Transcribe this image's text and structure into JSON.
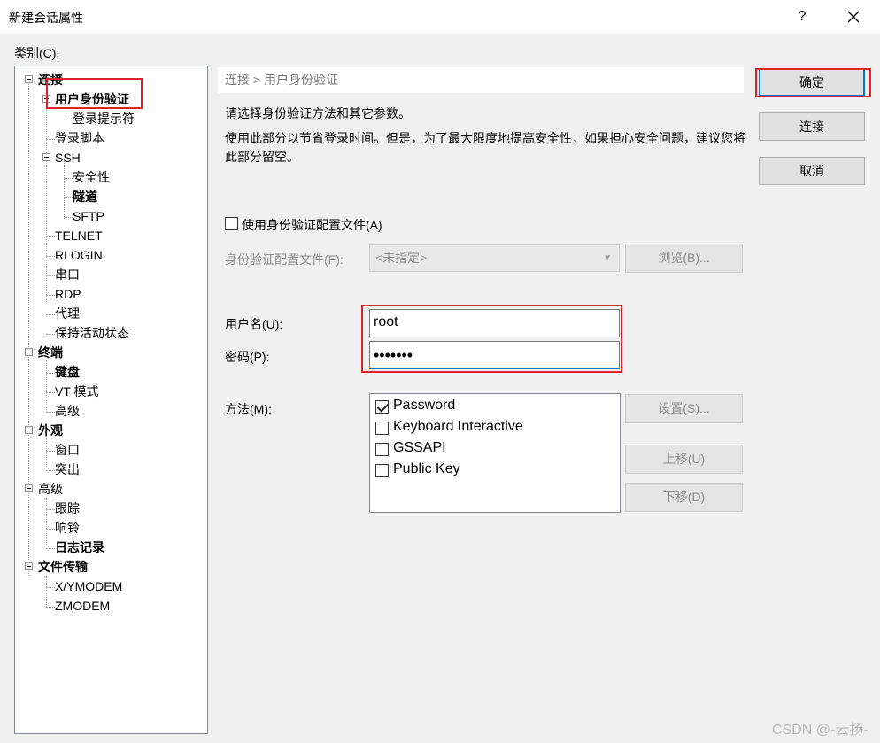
{
  "window": {
    "title": "新建会话属性",
    "help": "?",
    "close": "✕"
  },
  "category_label": "类别(C):",
  "tree": {
    "items": [
      {
        "label": "连接",
        "bold": true
      },
      {
        "label": "用户身份验证",
        "bold": true
      },
      {
        "label": "登录提示符",
        "bold": false
      },
      {
        "label": "登录脚本",
        "bold": false
      },
      {
        "label": "SSH",
        "bold": false
      },
      {
        "label": "安全性",
        "bold": false
      },
      {
        "label": "隧道",
        "bold": true
      },
      {
        "label": "SFTP",
        "bold": false
      },
      {
        "label": "TELNET",
        "bold": false
      },
      {
        "label": "RLOGIN",
        "bold": false
      },
      {
        "label": "串口",
        "bold": false
      },
      {
        "label": "RDP",
        "bold": false
      },
      {
        "label": "代理",
        "bold": false
      },
      {
        "label": "保持活动状态",
        "bold": false
      },
      {
        "label": "终端",
        "bold": true
      },
      {
        "label": "键盘",
        "bold": true
      },
      {
        "label": "VT 模式",
        "bold": false
      },
      {
        "label": "高级",
        "bold": false
      },
      {
        "label": "外观",
        "bold": true
      },
      {
        "label": "窗口",
        "bold": false
      },
      {
        "label": "突出",
        "bold": false
      },
      {
        "label": "高级",
        "bold": false
      },
      {
        "label": "跟踪",
        "bold": false
      },
      {
        "label": "响铃",
        "bold": false
      },
      {
        "label": "日志记录",
        "bold": true
      },
      {
        "label": "文件传输",
        "bold": true
      },
      {
        "label": "X/YMODEM",
        "bold": false
      },
      {
        "label": "ZMODEM",
        "bold": false
      }
    ]
  },
  "main": {
    "breadcrumb": "连接 > 用户身份验证",
    "desc1": "请选择身份验证方法和其它参数。",
    "desc2": "使用此部分以节省登录时间。但是，为了最大限度地提高安全性，如果担心安全问题，建议您将此部分留空。",
    "use_profile_label": "使用身份验证配置文件(A)",
    "use_profile_checked": false,
    "profile_file_label": "身份验证配置文件(F):",
    "profile_select_value": "<未指定>",
    "browse_button": "浏览(B)...",
    "username_label": "用户名(U):",
    "username_value": "root",
    "password_label": "密码(P):",
    "password_value": "•••••••",
    "method_label": "方法(M):",
    "methods": [
      {
        "label": "Password",
        "checked": true
      },
      {
        "label": "Keyboard Interactive",
        "checked": false
      },
      {
        "label": "GSSAPI",
        "checked": false
      },
      {
        "label": "Public Key",
        "checked": false
      }
    ],
    "settings_button": "设置(S)...",
    "move_up_button": "上移(U)",
    "move_down_button": "下移(D)"
  },
  "actions": {
    "ok": "确定",
    "connect": "连接",
    "cancel": "取消"
  },
  "watermark": "CSDN @-云扬-",
  "colors": {
    "highlight_red": "#e0202a",
    "focus_blue": "#0078d7"
  }
}
